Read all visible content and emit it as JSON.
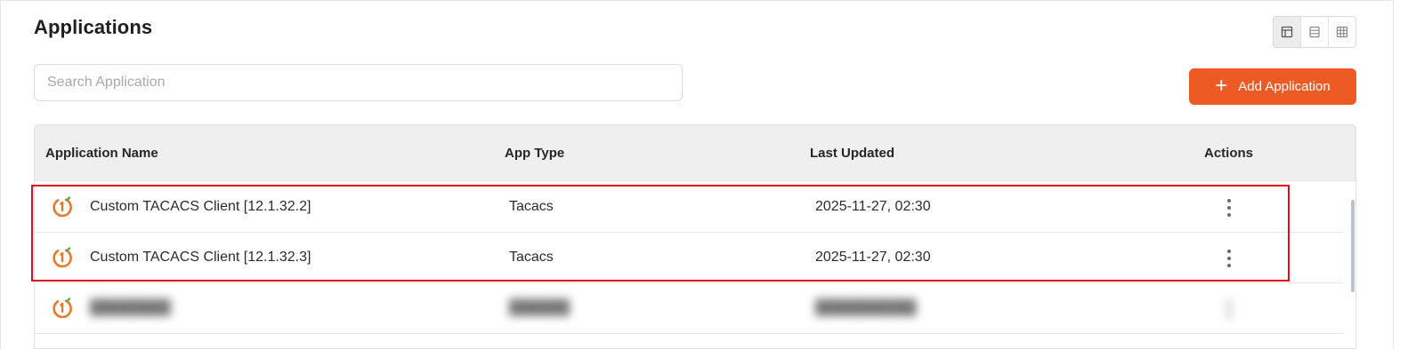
{
  "page": {
    "title": "Applications"
  },
  "view_toggle": {
    "options": [
      {
        "name": "table-view",
        "icon": "table-layout-icon",
        "active": true
      },
      {
        "name": "list-view",
        "icon": "list-layout-icon",
        "active": false
      },
      {
        "name": "grid-view",
        "icon": "grid-layout-icon",
        "active": false
      }
    ]
  },
  "search": {
    "placeholder": "Search Application",
    "value": ""
  },
  "add_button": {
    "label": "Add Application",
    "icon": "plus-icon",
    "color": "#ee5a24"
  },
  "table": {
    "headers": {
      "name": "Application Name",
      "type": "App Type",
      "updated": "Last Updated",
      "actions": "Actions"
    },
    "rows": [
      {
        "name": "Custom TACACS Client [12.1.32.2]",
        "type": "Tacacs",
        "updated": "2025-11-27, 02:30",
        "icon": "tacacs-app-icon",
        "blurred": false
      },
      {
        "name": "Custom TACACS Client [12.1.32.3]",
        "type": "Tacacs",
        "updated": "2025-11-27, 02:30",
        "icon": "tacacs-app-icon",
        "blurred": false
      },
      {
        "name": "████████",
        "type": "██████",
        "updated": "██████████",
        "icon": "tacacs-app-icon",
        "blurred": true
      }
    ]
  },
  "colors": {
    "accent": "#ee5a24",
    "highlight_border": "#e0101a",
    "icon_orange": "#e8792b",
    "icon_green": "#4caf50"
  }
}
